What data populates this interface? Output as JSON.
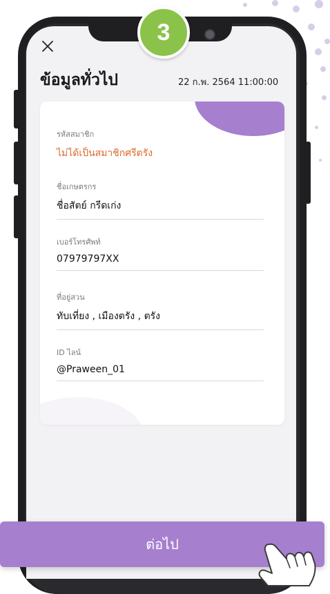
{
  "step": {
    "number": "3"
  },
  "header": {
    "close_icon": "close-icon",
    "title": "ข้อมูลทั่วไป",
    "timestamp": "22 ก.พ. 2564  11:00:00"
  },
  "card": {
    "fields": [
      {
        "label": "รหัสสมาชิก",
        "value": "ไม่ได้เป็นสมาชิกศรีตรัง"
      },
      {
        "label": "ชื่อเกษตรกร",
        "value": "ชื่อสัตย์ กรีดเก่ง"
      },
      {
        "label": "เบอร์โทรศัพท์",
        "value": "07979797XX"
      },
      {
        "label": "ที่อยู่สวน",
        "value": "ทับเที่ยง , เมืองตรัง , ตรัง"
      },
      {
        "label": "ID ไลน์",
        "value": "@Praween_01"
      }
    ]
  },
  "footer": {
    "next_label": "ต่อไป"
  },
  "colors": {
    "accent": "#a67fcf",
    "step_badge": "#8bc34a",
    "member_status": "#e0682a"
  }
}
